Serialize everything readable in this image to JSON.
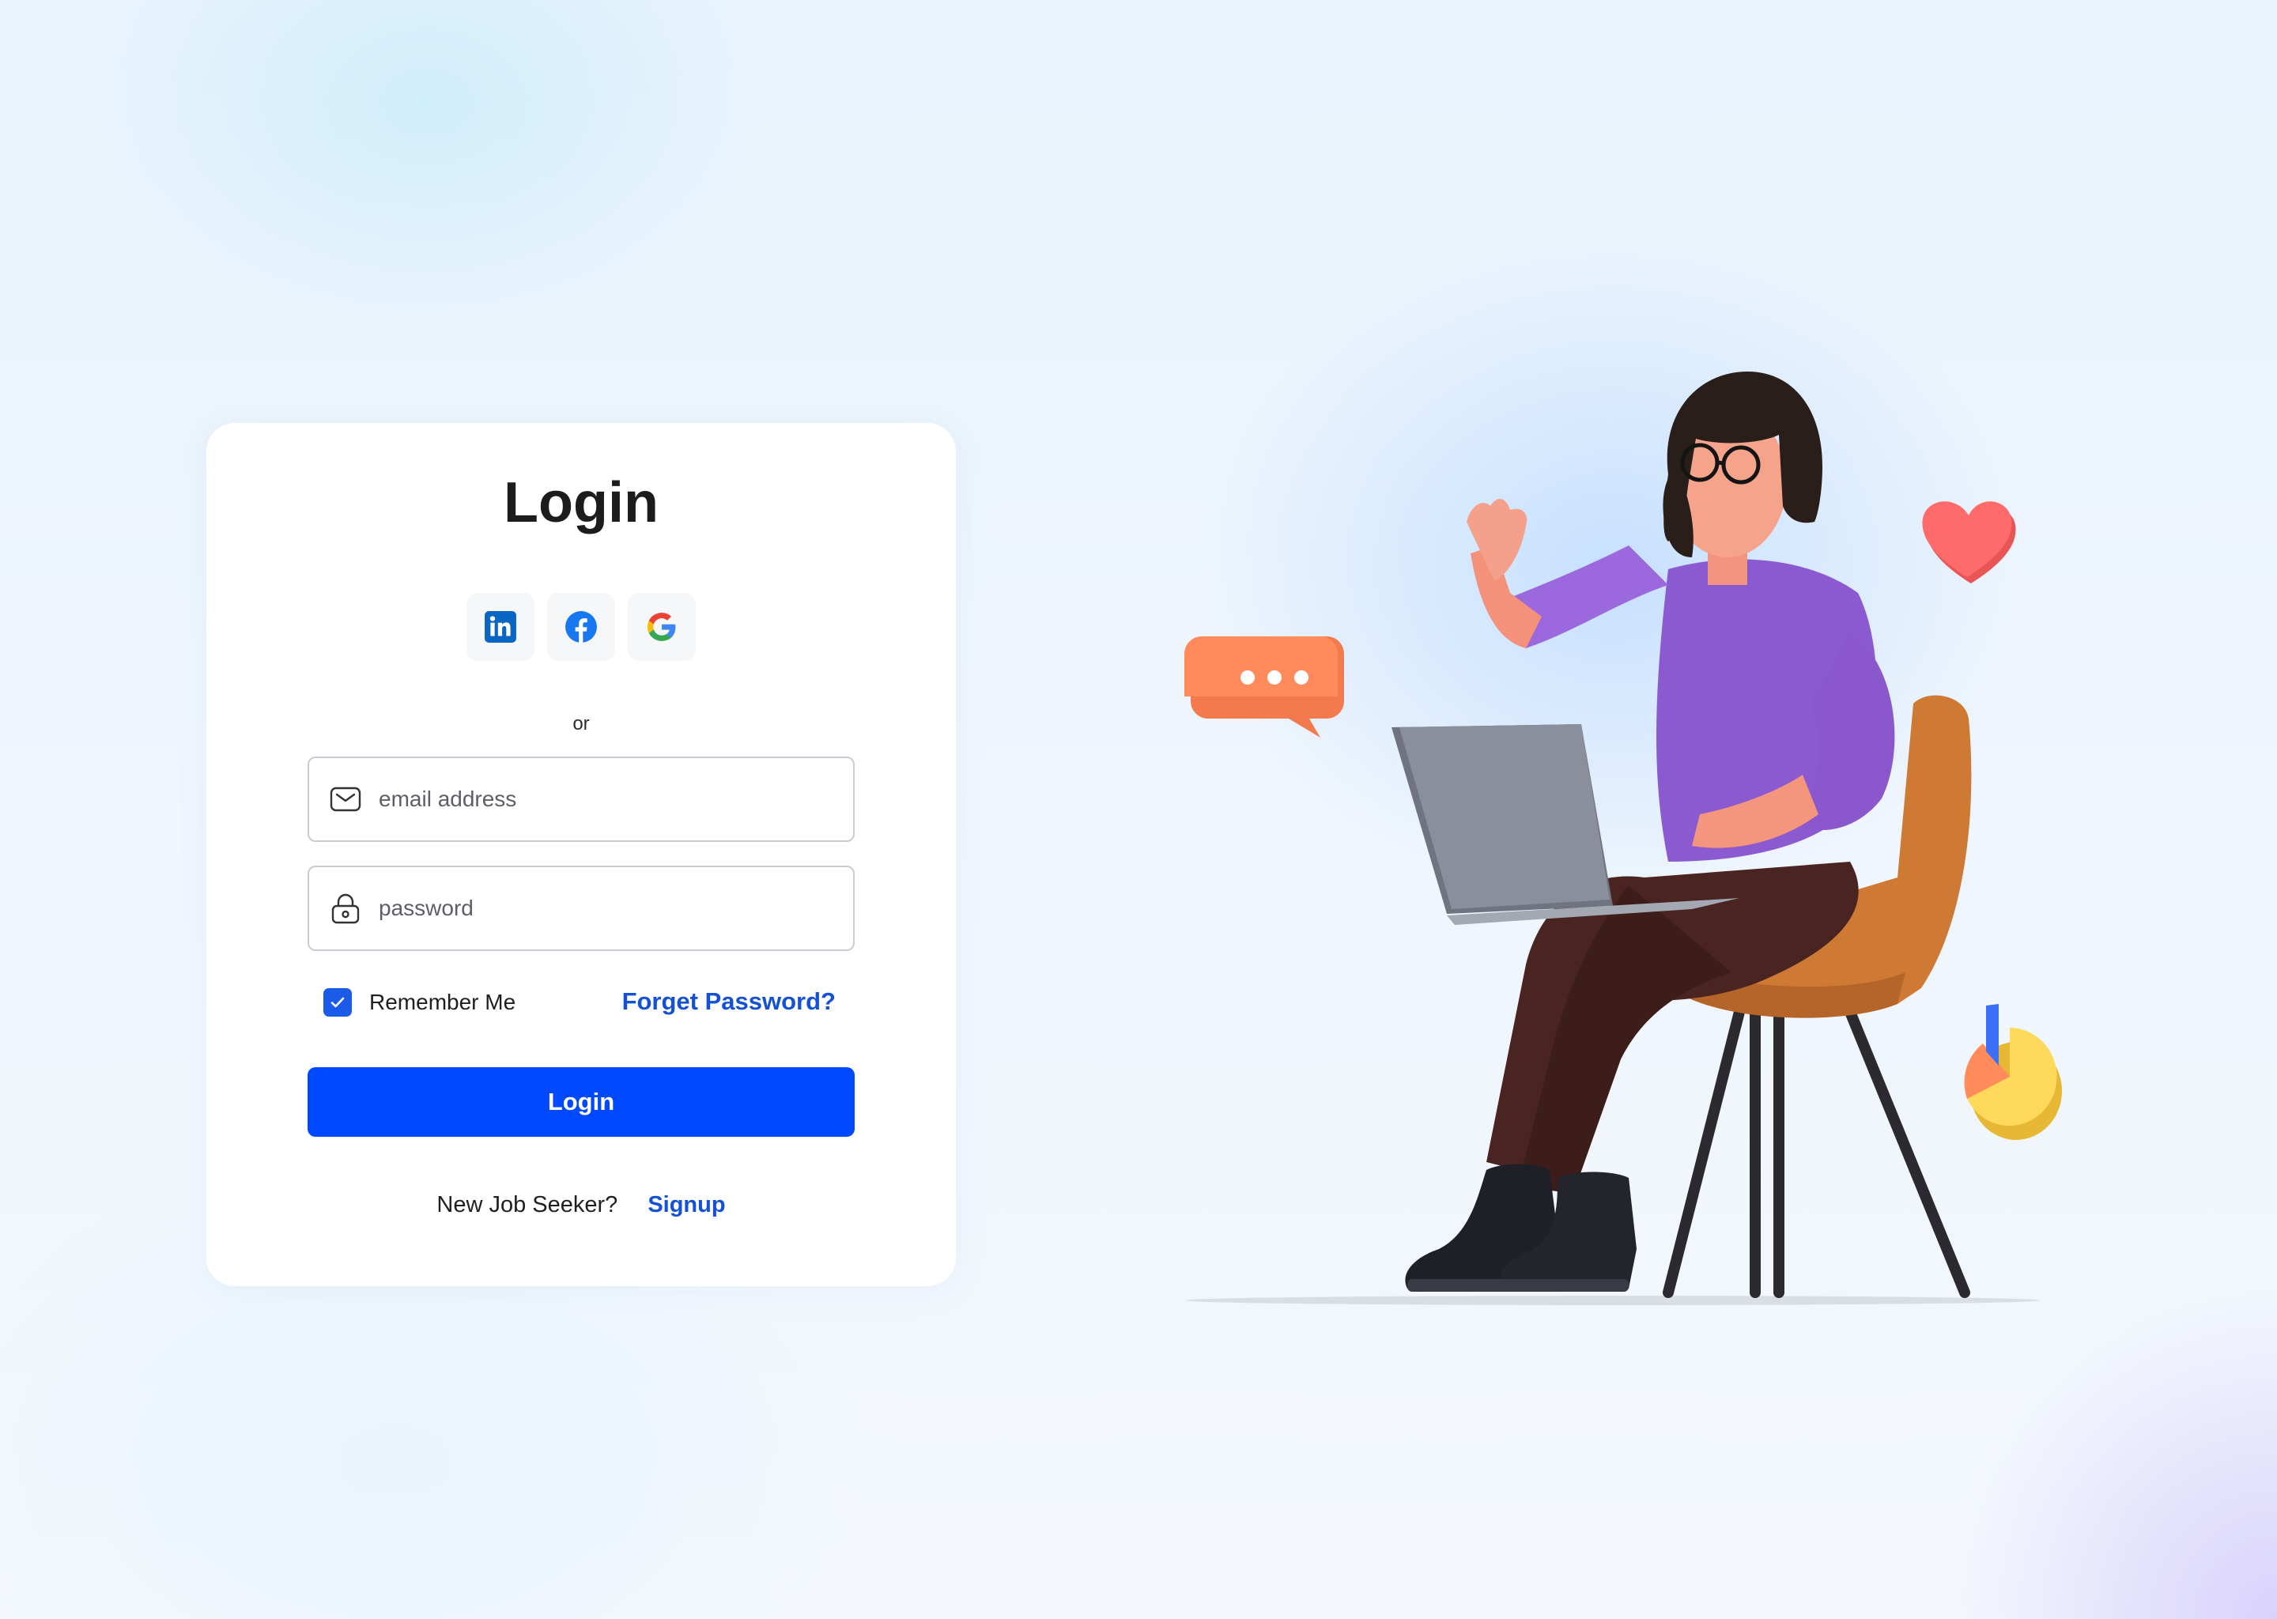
{
  "login": {
    "title": "Login",
    "social": [
      {
        "name": "linkedin",
        "icon": "linkedin-icon"
      },
      {
        "name": "facebook",
        "icon": "facebook-icon"
      },
      {
        "name": "google",
        "icon": "google-icon"
      }
    ],
    "or_label": "or",
    "email_placeholder": "email address",
    "password_placeholder": "password",
    "remember_label": "Remember Me",
    "remember_checked": true,
    "forgot_label": "Forget Password?",
    "submit_label": "Login",
    "signup_prompt": "New Job Seeker?",
    "signup_link": "Signup"
  },
  "colors": {
    "primary": "#0049ff",
    "link": "#1451d6",
    "card": "#ffffff",
    "field_border": "#c9ccd2"
  },
  "illustration": {
    "subject": "woman-on-chair-with-laptop",
    "decorations": [
      "chat-bubble-icon",
      "heart-icon",
      "pie-chart-icon"
    ]
  }
}
